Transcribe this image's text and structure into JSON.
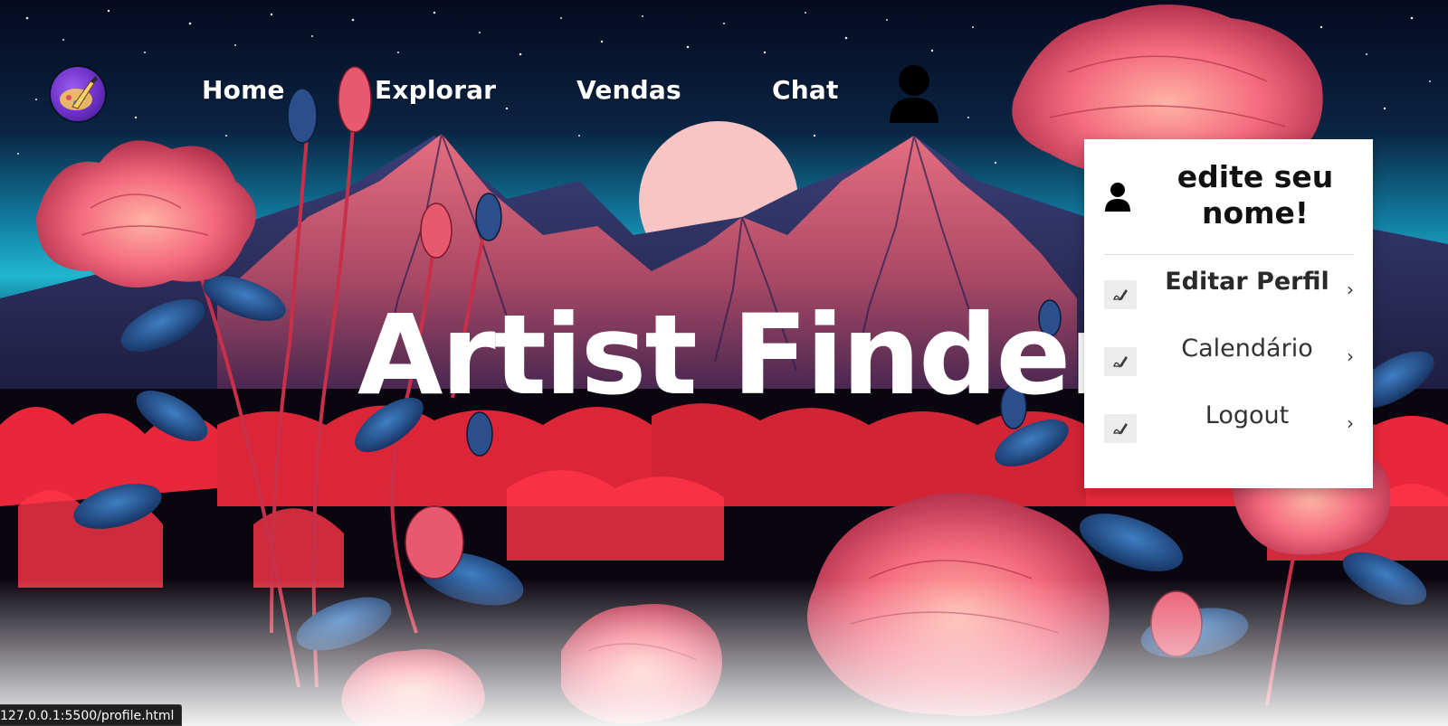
{
  "nav": {
    "logo_icon": "palette-brush-logo-icon",
    "links": [
      "Home",
      "Explorar",
      "Vendas",
      "Chat"
    ],
    "profile_icon": "user-icon"
  },
  "hero": {
    "title": "Artist Finder"
  },
  "dropdown": {
    "user_icon": "user-icon",
    "name": "edite seu nome!",
    "items": [
      {
        "label": "Editar Perfil",
        "icon": "edit-icon",
        "chevron": "›"
      },
      {
        "label": "Calendário",
        "icon": "edit-icon",
        "chevron": "›"
      },
      {
        "label": "Logout",
        "icon": "edit-icon",
        "chevron": "›"
      }
    ]
  },
  "status": {
    "url": "127.0.0.1:5500/profile.html"
  },
  "colors": {
    "dropdown_bg": "#ffffff",
    "nav_text": "#ffffff",
    "accent_coral": "#f0646e",
    "sky_teal": "#1aa2c4",
    "moon": "#f8c4c4"
  }
}
